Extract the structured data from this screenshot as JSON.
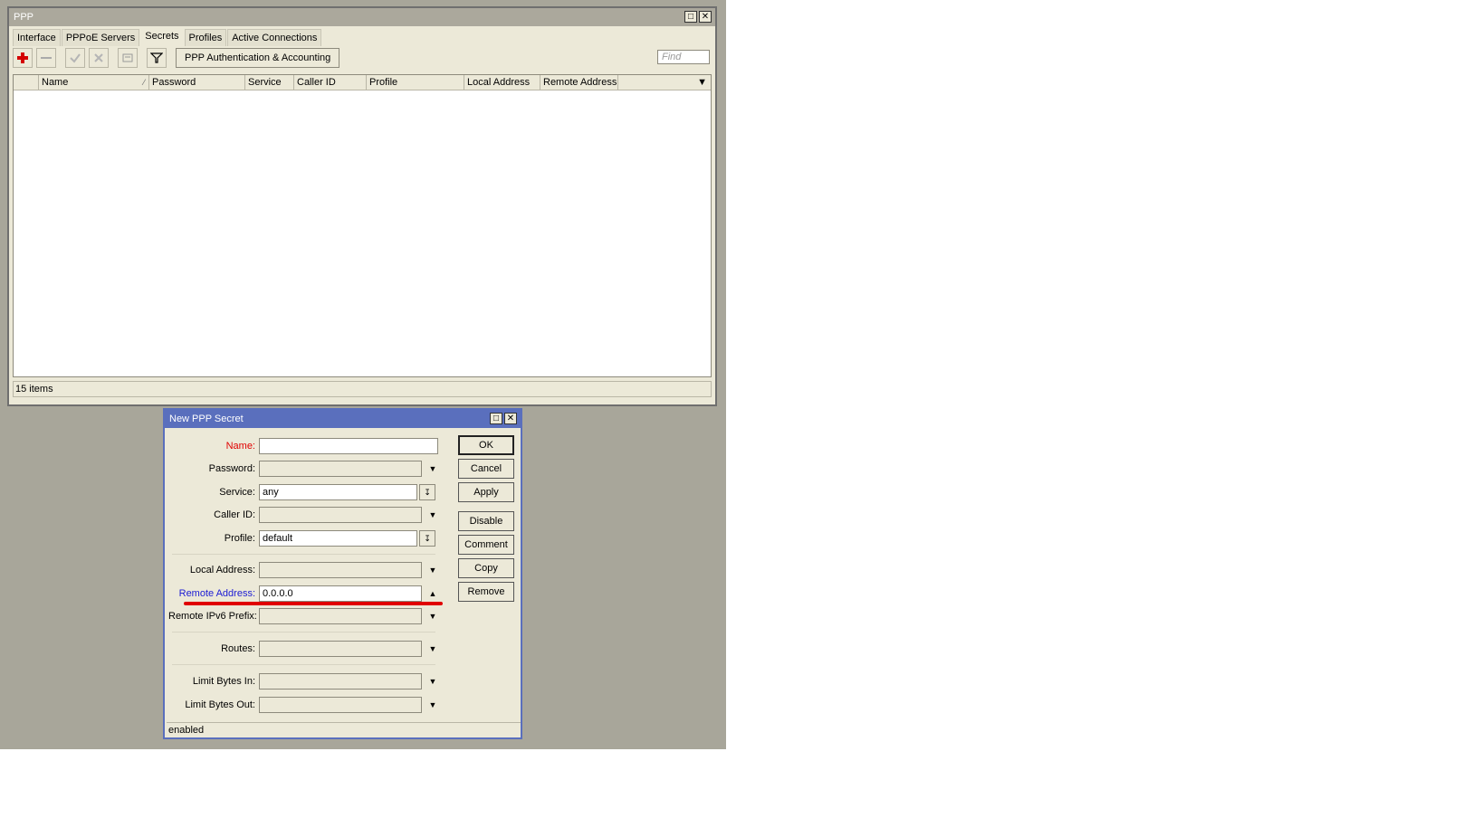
{
  "ppp_window": {
    "title": "PPP",
    "tabs": [
      {
        "label": "Interface"
      },
      {
        "label": "PPPoE Servers"
      },
      {
        "label": "Secrets"
      },
      {
        "label": "Profiles"
      },
      {
        "label": "Active Connections"
      }
    ],
    "selected_tab": "Secrets",
    "toolbar": {
      "auth_button": "PPP Authentication & Accounting",
      "find_placeholder": "Find",
      "icons": [
        "add-icon",
        "remove-icon",
        "enable-icon",
        "disable-icon",
        "comment-icon",
        "filter-icon"
      ]
    },
    "table": {
      "columns": [
        "",
        "Name",
        "Password",
        "Service",
        "Caller ID",
        "Profile",
        "Local Address",
        "Remote Address"
      ]
    },
    "status": "15 items"
  },
  "dialog": {
    "title": "New PPP Secret",
    "fields": {
      "name": {
        "label": "Name:",
        "value": ""
      },
      "password": {
        "label": "Password:",
        "value": ""
      },
      "service": {
        "label": "Service:",
        "value": "any"
      },
      "caller_id": {
        "label": "Caller ID:",
        "value": ""
      },
      "profile": {
        "label": "Profile:",
        "value": "default"
      },
      "local_address": {
        "label": "Local Address:",
        "value": ""
      },
      "remote_address": {
        "label": "Remote Address:",
        "value": "0.0.0.0"
      },
      "remote_ipv6_prefix": {
        "label": "Remote IPv6 Prefix:",
        "value": ""
      },
      "routes": {
        "label": "Routes:",
        "value": ""
      },
      "limit_bytes_in": {
        "label": "Limit Bytes In:",
        "value": ""
      },
      "limit_bytes_out": {
        "label": "Limit Bytes Out:",
        "value": ""
      }
    },
    "buttons": {
      "ok": "OK",
      "cancel": "Cancel",
      "apply": "Apply",
      "disable": "Disable",
      "comment": "Comment",
      "copy": "Copy",
      "remove": "Remove"
    },
    "status": "enabled"
  },
  "colors": {
    "window_bg": "#ece9d8",
    "desktop_bg": "#a8a69a",
    "active_title": "#5a6fbd",
    "required_label": "#e00000",
    "link_label": "#1b1bd4",
    "highlight_underline": "#e00000"
  }
}
